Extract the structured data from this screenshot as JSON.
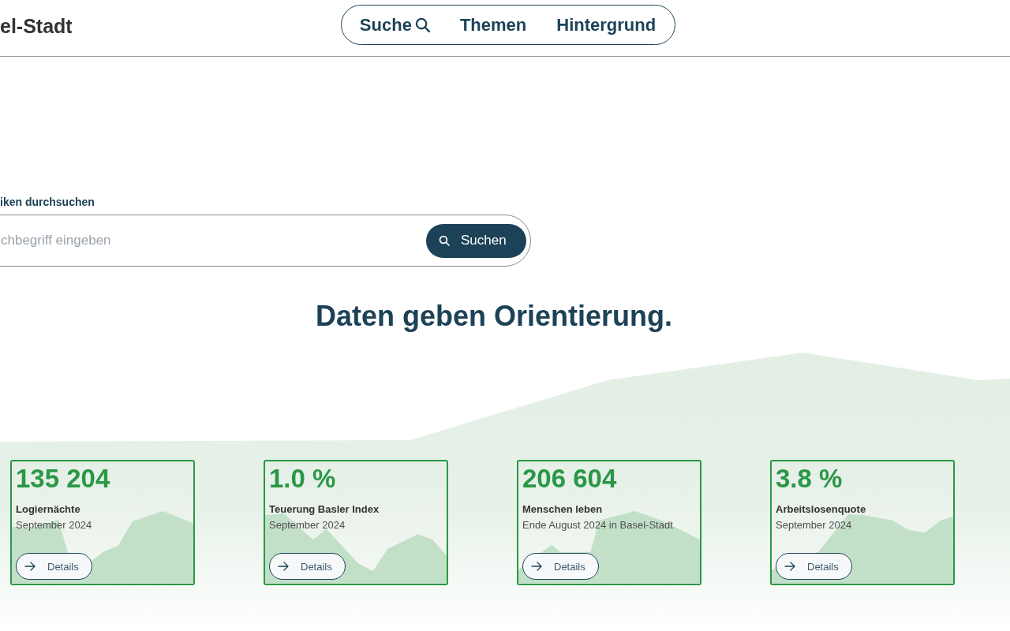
{
  "header": {
    "logo": "el-Stadt",
    "nav": [
      {
        "label": "Suche",
        "kind": "search"
      },
      {
        "label": "Themen",
        "kind": "link"
      },
      {
        "label": "Hintergrund",
        "kind": "link"
      }
    ]
  },
  "search": {
    "label": "iken durchsuchen",
    "placeholder": "chbegriff eingeben",
    "button": "Suchen"
  },
  "headline": "Daten geben Orientierung.",
  "cards": [
    {
      "value": "135 204",
      "title": "Logiernächte",
      "subtitle": "September 2024",
      "button": "Details"
    },
    {
      "value": "1.0 %",
      "title": "Teuerung Basler Index",
      "subtitle": "September 2024",
      "button": "Details"
    },
    {
      "value": "206 604",
      "title": "Menschen leben",
      "subtitle": "Ende August 2024 in Basel-Stadt",
      "button": "Details"
    },
    {
      "value": "3.8 %",
      "title": "Arbeitslosenquote",
      "subtitle": "September 2024",
      "button": "Details"
    }
  ]
}
